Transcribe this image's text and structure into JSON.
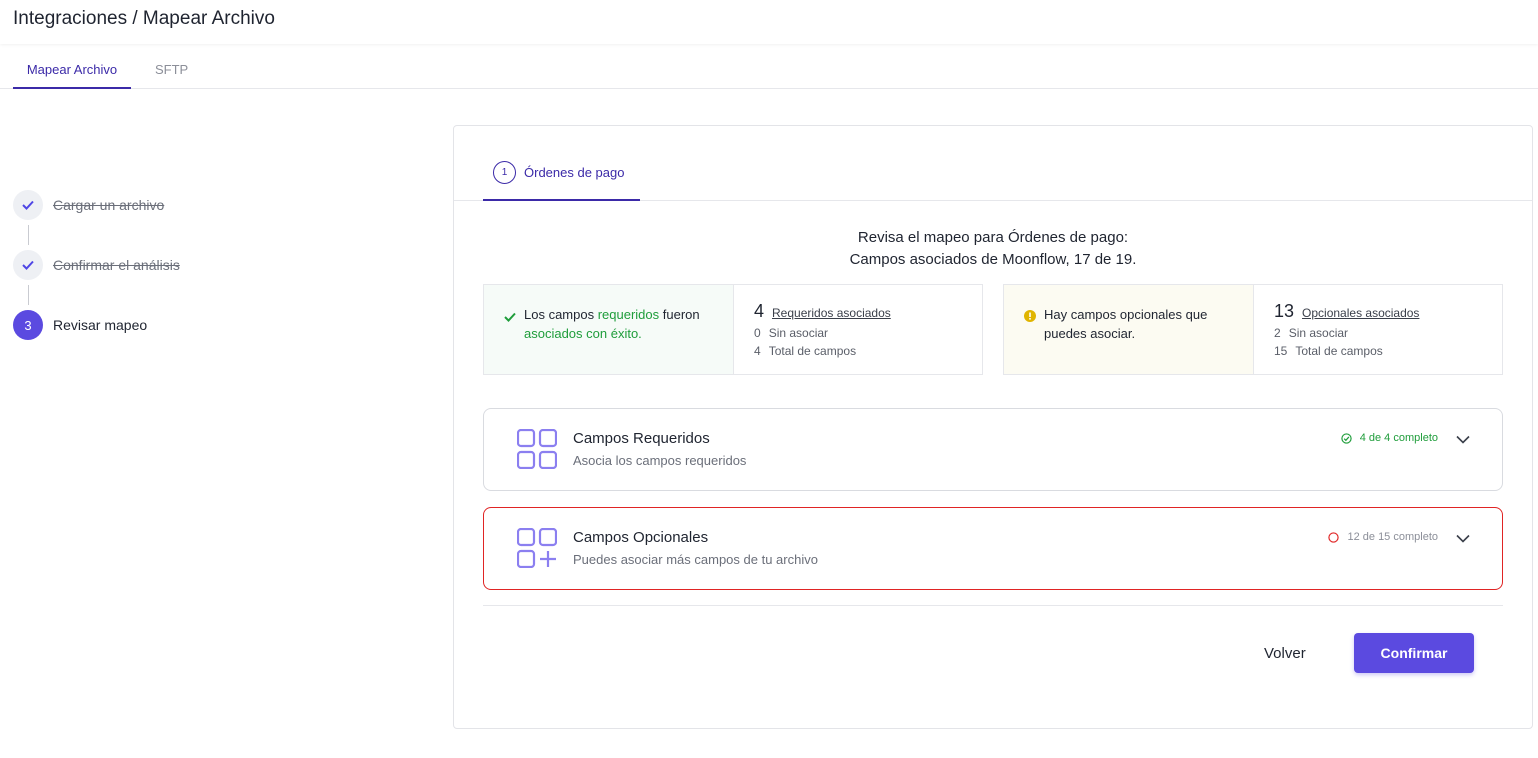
{
  "header": {
    "title": "Integraciones / Mapear Archivo"
  },
  "tabs": [
    {
      "label": "Mapear Archivo"
    },
    {
      "label": "SFTP"
    }
  ],
  "steps": [
    {
      "number": "✓",
      "label": "Cargar un archivo"
    },
    {
      "number": "✓",
      "label": "Confirmar el análisis"
    },
    {
      "number": "3",
      "label": "Revisar mapeo"
    }
  ],
  "card": {
    "tab": {
      "number": "1",
      "label": "Órdenes de pago"
    },
    "review_title": "Revisa el mapeo para Órdenes de pago:",
    "review_subtitle": "Campos asociados de Moonflow, 17 de 19.",
    "required_summary": {
      "msg_pre": "Los campos ",
      "msg_hl1": "requeridos",
      "msg_mid": " fueron ",
      "msg_hl2": "asociados con éxito.",
      "count": "4",
      "count_label": "Requeridos asociados",
      "unassigned_n": "0",
      "unassigned_label": "Sin asociar",
      "total_n": "4",
      "total_label": "Total de campos"
    },
    "optional_summary": {
      "msg": "Hay campos opcionales que puedes asociar.",
      "count": "13",
      "count_label": "Opcionales asociados",
      "unassigned_n": "2",
      "unassigned_label": "Sin asociar",
      "total_n": "15",
      "total_label": "Total de campos"
    },
    "sections": [
      {
        "title": "Campos Requeridos",
        "subtitle": "Asocia los campos requeridos",
        "status": "4 de 4 completo"
      },
      {
        "title": "Campos Opcionales",
        "subtitle": "Puedes asociar más campos de tu archivo",
        "status": "12 de 15 completo"
      }
    ],
    "buttons": {
      "back": "Volver",
      "confirm": "Confirmar"
    }
  },
  "colors": {
    "accent": "#5b4ae0",
    "success": "#1f9d3b",
    "error": "#e02424",
    "warning": "#e0b400"
  }
}
